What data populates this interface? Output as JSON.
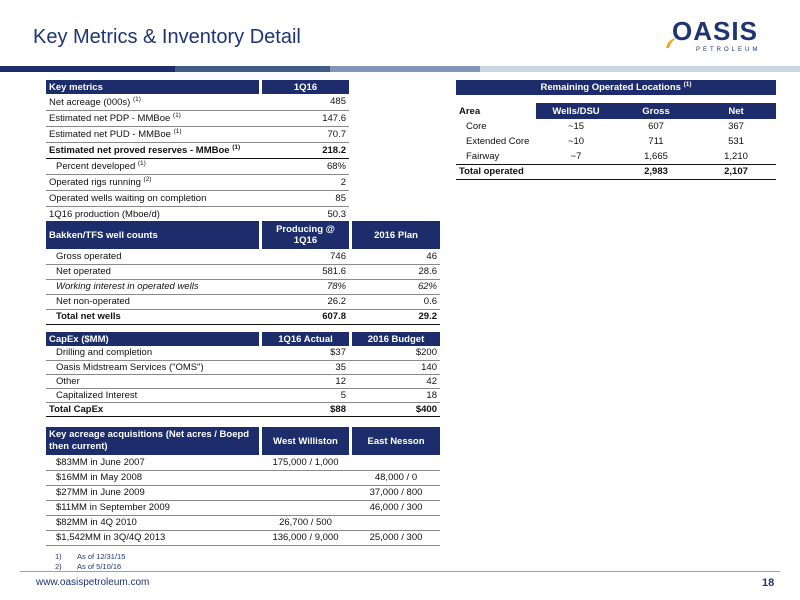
{
  "page_title": "Key Metrics & Inventory Detail",
  "logo": {
    "name": "OASIS",
    "sub": "PETROLEUM"
  },
  "colors": {
    "navy": "#1d2d6b",
    "title_blue": "#1d3575"
  },
  "key_metrics": {
    "header": [
      "Key metrics",
      "1Q16"
    ],
    "rows": [
      {
        "label": "Net acreage (000s)",
        "sup": "(1)",
        "value": "485"
      },
      {
        "label": "Estimated net PDP - MMBoe",
        "sup": "(1)",
        "value": "147.6"
      },
      {
        "label": "Estimated net PUD - MMBoe",
        "sup": "(1)",
        "value": "70.7"
      },
      {
        "label": "Estimated net proved reserves - MMBoe",
        "sup": "(1)",
        "value": "218.2"
      },
      {
        "label": "Percent developed",
        "sup": "(1)",
        "value": "68%"
      },
      {
        "label": "Operated rigs running",
        "sup": "(2)",
        "value": "2"
      },
      {
        "label": "Operated wells waiting on completion",
        "sup": "",
        "value": "85"
      },
      {
        "label": "1Q16 production (Mboe/d)",
        "sup": "",
        "value": "50.3"
      }
    ]
  },
  "remaining_locations": {
    "title": "Remaining Operated Locations",
    "title_sup": "(1)",
    "columns": [
      "Area",
      "Wells/DSU",
      "Gross",
      "Net"
    ],
    "rows": [
      {
        "area": "Core",
        "wells": "~15",
        "gross": "607",
        "net": "367"
      },
      {
        "area": "Extended Core",
        "wells": "~10",
        "gross": "711",
        "net": "531"
      },
      {
        "area": "Fairway",
        "wells": "~7",
        "gross": "1,665",
        "net": "1,210"
      }
    ],
    "total": {
      "area": "Total operated",
      "wells": "",
      "gross": "2,983",
      "net": "2,107"
    }
  },
  "bakken": {
    "header": [
      "Bakken/TFS well counts",
      "Producing @ 1Q16",
      "2016 Plan"
    ],
    "rows": [
      {
        "label": "Gross operated",
        "a": "746",
        "b": "46"
      },
      {
        "label": "Net operated",
        "a": "581.6",
        "b": "28.6"
      },
      {
        "label": "Working interest in operated wells",
        "a": "78%",
        "b": "62%"
      },
      {
        "label": "Net non-operated",
        "a": "26.2",
        "b": "0.6"
      }
    ],
    "total": {
      "label": "Total net wells",
      "a": "607.8",
      "b": "29.2"
    }
  },
  "capex": {
    "header": [
      "CapEx ($MM)",
      "1Q16 Actual",
      "2016 Budget"
    ],
    "rows": [
      {
        "label": "Drilling and completion",
        "a": "$37",
        "b": "$200"
      },
      {
        "label": "Oasis Midstream Services (\"OMS\")",
        "a": "35",
        "b": "140"
      },
      {
        "label": "Other",
        "a": "12",
        "b": "42"
      },
      {
        "label": "Capitalized Interest",
        "a": "5",
        "b": "18"
      }
    ],
    "total": {
      "label": "Total CapEx",
      "a": "$88",
      "b": "$400"
    }
  },
  "acquisitions": {
    "header": [
      "Key acreage acquisitions (Net acres / Boepd then current)",
      "West Williston",
      "East Nesson"
    ],
    "rows": [
      {
        "label": "$83MM in June 2007",
        "a": "175,000 / 1,000",
        "b": ""
      },
      {
        "label": "$16MM in May 2008",
        "a": "",
        "b": "48,000 / 0"
      },
      {
        "label": "$27MM in June 2009",
        "a": "",
        "b": "37,000 / 800"
      },
      {
        "label": "$11MM in September 2009",
        "a": "",
        "b": "46,000 / 300"
      },
      {
        "label": "$82MM in 4Q 2010",
        "a": "26,700 / 500",
        "b": ""
      },
      {
        "label": "$1,542MM in 3Q/4Q 2013",
        "a": "136,000 / 9,000",
        "b": "25,000 / 300"
      }
    ]
  },
  "footnotes": [
    {
      "num": "1)",
      "text": "As of 12/31/15"
    },
    {
      "num": "2)",
      "text": "As of 5/10/16"
    }
  ],
  "footer": {
    "url": "www.oasispetroleum.com",
    "page": "18"
  }
}
